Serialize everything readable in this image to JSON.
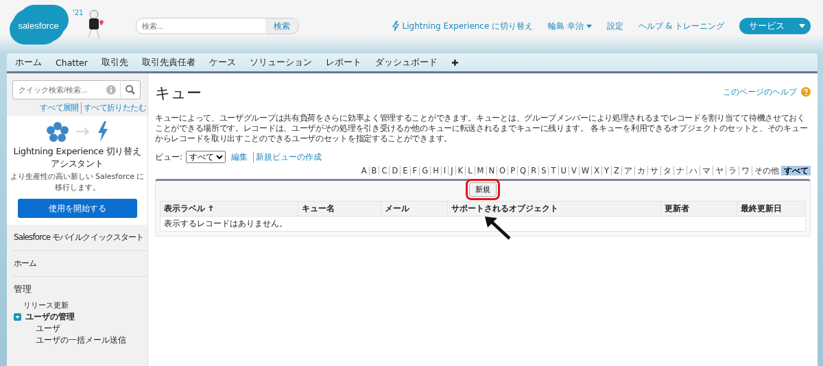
{
  "header": {
    "logo": "salesforce",
    "logo_badge": "'21",
    "search": {
      "placeholder": "検索...",
      "button": "検索"
    },
    "links": [
      {
        "kind": "lightning",
        "label": "Lightning Experience に切り替え"
      },
      {
        "kind": "menu",
        "label": "輪島 幸治"
      },
      {
        "kind": "plain",
        "label": "設定"
      },
      {
        "kind": "plain",
        "label": "ヘルプ & トレーニング"
      }
    ],
    "app_menu": "サービス"
  },
  "tabs": [
    {
      "label": "ホーム",
      "selected": false
    },
    {
      "label": "Chatter",
      "selected": false
    },
    {
      "label": "取引先",
      "selected": false
    },
    {
      "label": "取引先責任者",
      "selected": false
    },
    {
      "label": "ケース",
      "selected": false
    },
    {
      "label": "ソリューション",
      "selected": false
    },
    {
      "label": "レポート",
      "selected": false
    },
    {
      "label": "ダッシュボード",
      "selected": false
    },
    {
      "label": "✚",
      "selected": false
    }
  ],
  "sidebar": {
    "search": {
      "placeholder": "クイック検索/検索..."
    },
    "expand_all": "すべて展開",
    "collapse_all": "すべて折りたたむ",
    "promo": {
      "title": "Lightning Experience 切り替えアシスタント",
      "text": "より生産性の高い新しい Salesforce に移行します。",
      "button": "使用を開始する"
    },
    "sections": [
      {
        "label": "Salesforce モバイルクイックスタート"
      },
      {
        "label": "ホーム"
      }
    ],
    "setup": {
      "label": "管理",
      "items": [
        {
          "label": "リリース更新"
        },
        {
          "label": "ユーザの管理",
          "expanded": true,
          "children": [
            {
              "label": "ユーザ"
            },
            {
              "label": "ユーザの一括メール送信"
            }
          ]
        }
      ]
    }
  },
  "page": {
    "title": "キュー",
    "help_link": "このページのヘルプ",
    "description": "キューによって、ユーザグループは共有負荷をさらに効率よく管理することができます。キューとは、グループメンバーにより処理されるまでレコードを割り当てて待機させておくことができる場所です。レコードは、ユーザがその処理を引き受けるか他のキューに転送されるまでキューに残ります。 各キューを利用できるオブジェクトのセットと、そのキューからレコードを取り出すことのできるユーザのセットを指定することができます。",
    "view": {
      "label": "ビュー:",
      "value": "すべて",
      "edit": "編集",
      "create": "新規ビューの作成"
    },
    "letters": [
      {
        "label": "A",
        "selected": false
      },
      {
        "label": "B",
        "selected": false
      },
      {
        "label": "C",
        "selected": false
      },
      {
        "label": "D",
        "selected": false
      },
      {
        "label": "E",
        "selected": false
      },
      {
        "label": "F",
        "selected": false
      },
      {
        "label": "G",
        "selected": false
      },
      {
        "label": "H",
        "selected": false
      },
      {
        "label": "I",
        "selected": false
      },
      {
        "label": "J",
        "selected": false
      },
      {
        "label": "K",
        "selected": false
      },
      {
        "label": "L",
        "selected": false
      },
      {
        "label": "M",
        "selected": false
      },
      {
        "label": "N",
        "selected": false
      },
      {
        "label": "O",
        "selected": false
      },
      {
        "label": "P",
        "selected": false
      },
      {
        "label": "Q",
        "selected": false
      },
      {
        "label": "R",
        "selected": false
      },
      {
        "label": "S",
        "selected": false
      },
      {
        "label": "T",
        "selected": false
      },
      {
        "label": "U",
        "selected": false
      },
      {
        "label": "V",
        "selected": false
      },
      {
        "label": "W",
        "selected": false
      },
      {
        "label": "X",
        "selected": false
      },
      {
        "label": "Y",
        "selected": false
      },
      {
        "label": "Z",
        "selected": false
      },
      {
        "label": "ア",
        "selected": false
      },
      {
        "label": "カ",
        "selected": false
      },
      {
        "label": "サ",
        "selected": false
      },
      {
        "label": "タ",
        "selected": false
      },
      {
        "label": "ナ",
        "selected": false
      },
      {
        "label": "ハ",
        "selected": false
      },
      {
        "label": "マ",
        "selected": false
      },
      {
        "label": "ヤ",
        "selected": false
      },
      {
        "label": "ラ",
        "selected": false
      },
      {
        "label": "ワ",
        "selected": false
      },
      {
        "label": "その他",
        "selected": false
      },
      {
        "label": "すべて",
        "selected": true
      }
    ],
    "new_button": {
      "label": "新規",
      "highlighted": true
    },
    "table": {
      "columns": [
        {
          "label": "表示ラベル",
          "sorted": true
        },
        {
          "label": "キュー名",
          "sorted": false
        },
        {
          "label": "メール",
          "sorted": false
        },
        {
          "label": "サポートされるオブジェクト",
          "sorted": false
        },
        {
          "label": "更新者",
          "sorted": false
        },
        {
          "label": "最終更新日",
          "sorted": false
        }
      ],
      "empty_message": "表示するレコードはありません。"
    }
  }
}
